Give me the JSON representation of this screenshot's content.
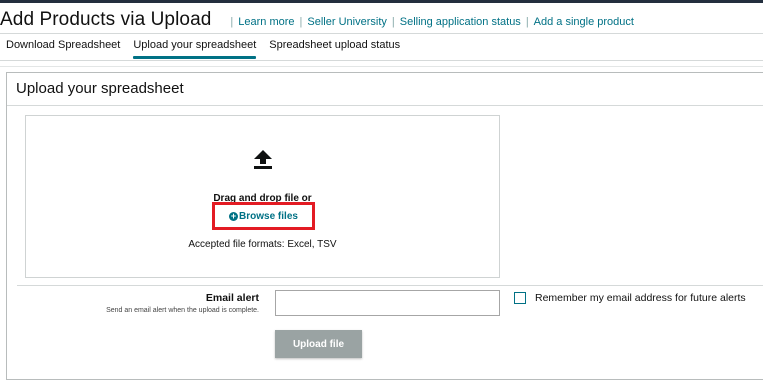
{
  "header": {
    "title": "Add Products via Upload",
    "links": [
      "Learn more",
      "Seller University",
      "Selling application status",
      "Add a single product"
    ]
  },
  "tabs": [
    {
      "label": "Download Spreadsheet",
      "active": false
    },
    {
      "label": "Upload your spreadsheet",
      "active": true
    },
    {
      "label": "Spreadsheet upload status",
      "active": false
    }
  ],
  "panel": {
    "title": "Upload your spreadsheet",
    "dropzone": {
      "icon": "upload-arrow-icon",
      "drag_text": "Drag and drop file or",
      "browse_label": "Browse files",
      "browse_icon": "plus-circle-icon",
      "formats_text": "Accepted file formats: Excel, TSV"
    },
    "email": {
      "label": "Email alert",
      "help": "Send an email alert when the upload is complete.",
      "value": "",
      "remember_label": "Remember my email address for future alerts",
      "remember_checked": false
    },
    "upload_button": "Upload file"
  },
  "colors": {
    "link": "#007185",
    "highlight_border": "#e31b23",
    "button_disabled": "#9aa3a3",
    "top_bar": "#232f3e"
  }
}
